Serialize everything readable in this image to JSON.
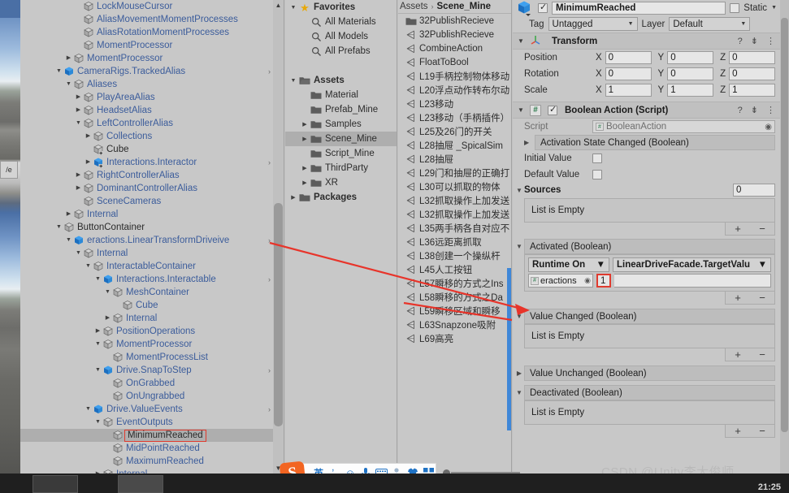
{
  "hierarchy": {
    "rows": [
      {
        "label": "LockMouseCursor",
        "indent": 5,
        "twist": "none",
        "icon": "cube-grey",
        "chevron": false,
        "selected": false,
        "dark": false
      },
      {
        "label": "AliasMovementMomentProcesses",
        "indent": 5,
        "twist": "none",
        "icon": "cube-grey",
        "chevron": false,
        "selected": false,
        "dark": false
      },
      {
        "label": "AliasRotationMomentProcesses",
        "indent": 5,
        "twist": "none",
        "icon": "cube-grey",
        "chevron": false,
        "selected": false,
        "dark": false
      },
      {
        "label": "MomentProcessor",
        "indent": 5,
        "twist": "none",
        "icon": "cube-grey",
        "chevron": false,
        "selected": false,
        "dark": false
      },
      {
        "label": "MomentProcessor",
        "indent": 4,
        "twist": "right",
        "icon": "cube-grey",
        "chevron": false,
        "selected": false,
        "dark": false
      },
      {
        "label": "CameraRigs.TrackedAlias",
        "indent": 3,
        "twist": "down",
        "icon": "cube-blue",
        "chevron": true,
        "selected": false,
        "dark": false
      },
      {
        "label": "Aliases",
        "indent": 4,
        "twist": "down",
        "icon": "cube-grey",
        "chevron": false,
        "selected": false,
        "dark": false
      },
      {
        "label": "PlayAreaAlias",
        "indent": 5,
        "twist": "right",
        "icon": "cube-grey",
        "chevron": false,
        "selected": false,
        "dark": false
      },
      {
        "label": "HeadsetAlias",
        "indent": 5,
        "twist": "right",
        "icon": "cube-grey",
        "chevron": false,
        "selected": false,
        "dark": false
      },
      {
        "label": "LeftControllerAlias",
        "indent": 5,
        "twist": "down",
        "icon": "cube-grey",
        "chevron": false,
        "selected": false,
        "dark": false
      },
      {
        "label": "Collections",
        "indent": 6,
        "twist": "right",
        "icon": "cube-grey",
        "chevron": false,
        "selected": false,
        "dark": false
      },
      {
        "label": "Cube",
        "indent": 6,
        "twist": "none",
        "icon": "cube-grey-plus",
        "chevron": false,
        "selected": false,
        "dark": true
      },
      {
        "label": "Interactions.Interactor",
        "indent": 6,
        "twist": "right",
        "icon": "cube-blue-plus",
        "chevron": true,
        "selected": false,
        "dark": false
      },
      {
        "label": "RightControllerAlias",
        "indent": 5,
        "twist": "right",
        "icon": "cube-grey",
        "chevron": false,
        "selected": false,
        "dark": false
      },
      {
        "label": "DominantControllerAlias",
        "indent": 5,
        "twist": "right",
        "icon": "cube-grey",
        "chevron": false,
        "selected": false,
        "dark": false
      },
      {
        "label": "SceneCameras",
        "indent": 5,
        "twist": "none",
        "icon": "cube-grey",
        "chevron": false,
        "selected": false,
        "dark": false
      },
      {
        "label": "Internal",
        "indent": 4,
        "twist": "right",
        "icon": "cube-grey",
        "chevron": false,
        "selected": false,
        "dark": false
      },
      {
        "label": "ButtonContainer",
        "indent": 3,
        "twist": "down",
        "icon": "cube-grey",
        "chevron": false,
        "selected": false,
        "dark": true
      },
      {
        "label": "eractions.LinearTransformDriveive",
        "indent": 4,
        "twist": "down",
        "icon": "cube-blue",
        "chevron": true,
        "selected": false,
        "dark": false
      },
      {
        "label": "Internal",
        "indent": 5,
        "twist": "down",
        "icon": "cube-grey",
        "chevron": false,
        "selected": false,
        "dark": false
      },
      {
        "label": "InteractableContainer",
        "indent": 6,
        "twist": "down",
        "icon": "cube-grey",
        "chevron": false,
        "selected": false,
        "dark": false
      },
      {
        "label": "Interactions.Interactable",
        "indent": 7,
        "twist": "down",
        "icon": "cube-blue",
        "chevron": true,
        "selected": false,
        "dark": false
      },
      {
        "label": "MeshContainer",
        "indent": 8,
        "twist": "down",
        "icon": "cube-grey",
        "chevron": false,
        "selected": false,
        "dark": false
      },
      {
        "label": "Cube",
        "indent": 9,
        "twist": "none",
        "icon": "cube-grey",
        "chevron": false,
        "selected": false,
        "dark": false
      },
      {
        "label": "Internal",
        "indent": 8,
        "twist": "right",
        "icon": "cube-grey",
        "chevron": false,
        "selected": false,
        "dark": false
      },
      {
        "label": "PositionOperations",
        "indent": 7,
        "twist": "right",
        "icon": "cube-grey",
        "chevron": false,
        "selected": false,
        "dark": false
      },
      {
        "label": "MomentProcessor",
        "indent": 7,
        "twist": "down",
        "icon": "cube-grey",
        "chevron": false,
        "selected": false,
        "dark": false
      },
      {
        "label": "MomentProcessList",
        "indent": 8,
        "twist": "none",
        "icon": "cube-grey",
        "chevron": false,
        "selected": false,
        "dark": false
      },
      {
        "label": "Drive.SnapToStep",
        "indent": 7,
        "twist": "down",
        "icon": "cube-blue",
        "chevron": true,
        "selected": false,
        "dark": false
      },
      {
        "label": "OnGrabbed",
        "indent": 8,
        "twist": "none",
        "icon": "cube-grey",
        "chevron": false,
        "selected": false,
        "dark": false
      },
      {
        "label": "OnUngrabbed",
        "indent": 8,
        "twist": "none",
        "icon": "cube-grey",
        "chevron": false,
        "selected": false,
        "dark": false
      },
      {
        "label": "Drive.ValueEvents",
        "indent": 6,
        "twist": "down",
        "icon": "cube-blue",
        "chevron": true,
        "selected": false,
        "dark": false
      },
      {
        "label": "EventOutputs",
        "indent": 7,
        "twist": "down",
        "icon": "cube-grey",
        "chevron": false,
        "selected": false,
        "dark": false
      },
      {
        "label": "MinimumReached",
        "indent": 8,
        "twist": "none",
        "icon": "cube-grey",
        "chevron": false,
        "selected": true,
        "dark": true,
        "boxed": true
      },
      {
        "label": "MidPointReached",
        "indent": 8,
        "twist": "none",
        "icon": "cube-grey",
        "chevron": false,
        "selected": false,
        "dark": false
      },
      {
        "label": "MaximumReached",
        "indent": 8,
        "twist": "none",
        "icon": "cube-grey",
        "chevron": false,
        "selected": false,
        "dark": false
      },
      {
        "label": "Internal",
        "indent": 7,
        "twist": "right",
        "icon": "cube-grey",
        "chevron": false,
        "selected": false,
        "dark": false
      }
    ]
  },
  "project_tree": {
    "rows": [
      {
        "label": "Favorites",
        "indent": 0,
        "twist": "down",
        "icon": "star",
        "bold": true,
        "selected": false
      },
      {
        "label": "All Materials",
        "indent": 1,
        "twist": "none",
        "icon": "search",
        "bold": false,
        "selected": false
      },
      {
        "label": "All Models",
        "indent": 1,
        "twist": "none",
        "icon": "search",
        "bold": false,
        "selected": false
      },
      {
        "label": "All Prefabs",
        "indent": 1,
        "twist": "none",
        "icon": "search",
        "bold": false,
        "selected": false
      },
      {
        "label": "",
        "indent": 0,
        "twist": "none",
        "icon": "none",
        "bold": false,
        "selected": false
      },
      {
        "label": "Assets",
        "indent": 0,
        "twist": "down",
        "icon": "folder-open",
        "bold": true,
        "selected": false
      },
      {
        "label": "Material",
        "indent": 1,
        "twist": "none",
        "icon": "folder",
        "bold": false,
        "selected": false
      },
      {
        "label": "Prefab_Mine",
        "indent": 1,
        "twist": "none",
        "icon": "folder",
        "bold": false,
        "selected": false
      },
      {
        "label": "Samples",
        "indent": 1,
        "twist": "right",
        "icon": "folder",
        "bold": false,
        "selected": false
      },
      {
        "label": "Scene_Mine",
        "indent": 1,
        "twist": "right",
        "icon": "folder",
        "bold": false,
        "selected": true
      },
      {
        "label": "Script_Mine",
        "indent": 1,
        "twist": "none",
        "icon": "folder",
        "bold": false,
        "selected": false
      },
      {
        "label": "ThirdParty",
        "indent": 1,
        "twist": "right",
        "icon": "folder",
        "bold": false,
        "selected": false
      },
      {
        "label": "XR",
        "indent": 1,
        "twist": "right",
        "icon": "folder",
        "bold": false,
        "selected": false
      },
      {
        "label": "Packages",
        "indent": 0,
        "twist": "right",
        "icon": "folder",
        "bold": true,
        "selected": false
      }
    ]
  },
  "asset_list": {
    "breadcrumb_root": "Assets",
    "breadcrumb_sep": "›",
    "breadcrumb_current": "Scene_Mine",
    "items": [
      {
        "label": "32PublishRecieve",
        "icon": "folder"
      },
      {
        "label": "32PublishRecieve",
        "icon": "scene"
      },
      {
        "label": "CombineAction",
        "icon": "scene"
      },
      {
        "label": "FloatToBool",
        "icon": "scene"
      },
      {
        "label": "L19手柄控制物体移动",
        "icon": "scene"
      },
      {
        "label": "L20浮点动作转布尔动",
        "icon": "scene"
      },
      {
        "label": "L23移动",
        "icon": "scene"
      },
      {
        "label": "L23移动（手柄插件）",
        "icon": "scene"
      },
      {
        "label": "L25及26门的开关",
        "icon": "scene"
      },
      {
        "label": "L28抽屉 _SpicalSim",
        "icon": "scene"
      },
      {
        "label": "L28抽屉",
        "icon": "scene"
      },
      {
        "label": "L29门和抽屉的正确打",
        "icon": "scene"
      },
      {
        "label": "L30可以抓取的物体",
        "icon": "scene"
      },
      {
        "label": "L32抓取操作上加发送",
        "icon": "scene"
      },
      {
        "label": "L32抓取操作上加发送",
        "icon": "scene"
      },
      {
        "label": "L35两手柄各自对应不",
        "icon": "scene"
      },
      {
        "label": "L36远距离抓取",
        "icon": "scene"
      },
      {
        "label": "L38创建一个操纵杆",
        "icon": "scene"
      },
      {
        "label": "L45人工按钮",
        "icon": "scene"
      },
      {
        "label": "L57瞬移的方式之Ins",
        "icon": "scene"
      },
      {
        "label": "L58瞬移的方式之Da",
        "icon": "scene"
      },
      {
        "label": "L59瞬移区域和瞬移",
        "icon": "scene"
      },
      {
        "label": "L63Snapzone吸附",
        "icon": "scene"
      },
      {
        "label": "L69高亮",
        "icon": "scene"
      }
    ]
  },
  "inspector": {
    "object_name": "MinimumReached",
    "enabled_checked": true,
    "static_label": "Static",
    "static_checked": false,
    "tag_label": "Tag",
    "tag_value": "Untagged",
    "layer_label": "Layer",
    "layer_value": "Default",
    "transform": {
      "title": "Transform",
      "rows": [
        {
          "name": "Position",
          "x": "0",
          "y": "0",
          "z": "0"
        },
        {
          "name": "Rotation",
          "x": "0",
          "y": "0",
          "z": "0"
        },
        {
          "name": "Scale",
          "x": "1",
          "y": "1",
          "z": "1"
        }
      ],
      "axis_x": "X",
      "axis_y": "Y",
      "axis_z": "Z"
    },
    "boolean_action": {
      "title": "Boolean Action (Script)",
      "enabled_checked": true,
      "script_label": "Script",
      "script_value": "BooleanAction",
      "activation_state_changed": "Activation State Changed (Boolean)",
      "initial_value_label": "Initial Value",
      "initial_value_checked": false,
      "default_value_label": "Default Value",
      "default_value_checked": false,
      "sources_label": "Sources",
      "sources_count": "0",
      "sources_empty": "List is Empty",
      "plus": "+",
      "minus": "−",
      "events": [
        {
          "title": "Activated (Boolean)",
          "expanded": true,
          "empty_text": null,
          "entry": {
            "runtime_mode": "Runtime On",
            "method": "LinearDriveFacade.TargetValu",
            "object": "eractions",
            "argument": "1",
            "argument_marked": true
          }
        },
        {
          "title": "Value Changed (Boolean)",
          "expanded": true,
          "empty_text": "List is Empty",
          "entry": null
        },
        {
          "title": "Value Unchanged (Boolean)",
          "expanded": false,
          "empty_text": null,
          "entry": null
        },
        {
          "title": "Deactivated (Boolean)",
          "expanded": true,
          "empty_text": "List is Empty",
          "entry": null
        }
      ]
    }
  },
  "ime": {
    "lang": "英",
    "icons": [
      "comma-icon",
      "smiley-icon",
      "mic-icon",
      "keyboard-icon",
      "person-icon",
      "shirt-icon",
      "grid-icon"
    ]
  },
  "taskbar": {
    "time": "21:25"
  },
  "watermark": "CSDN @Unity李大俊师",
  "colors": {
    "panel_bg": "#c8c8c8",
    "hierarchy_blue_text": "#3b5c9b",
    "selection": "#aeaeae",
    "annotation_red": "#e03b2f",
    "unity_blue_icon": "#1c87d8"
  }
}
